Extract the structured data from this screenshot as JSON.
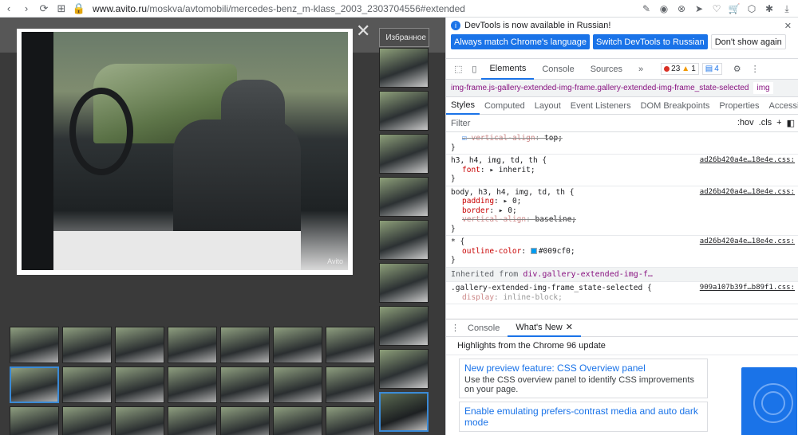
{
  "browser": {
    "url_prefix": "www.avito.ru",
    "url_path": "/moskva/avtomobili/mercedes-benz_m-klass_2003_2303704556#extended"
  },
  "gallery": {
    "favorite_label": "Избранное",
    "watermark": "Avito",
    "close_symbol": "✕",
    "side_thumbs_count": 9,
    "grid_rows": 3
  },
  "devtools": {
    "banner": {
      "message": "DevTools is now available in Russian!",
      "btn_match": "Always match Chrome's language",
      "btn_switch": "Switch DevTools to Russian",
      "btn_dont": "Don't show again"
    },
    "tabs": [
      "Elements",
      "Console",
      "Sources"
    ],
    "more": "»",
    "errors": "23",
    "warnings": "1",
    "messages": "4",
    "breadcrumb": "img-frame.js-gallery-extended-img-frame.gallery-extended-img-frame_state-selected",
    "breadcrumb_sel": "img",
    "subtabs": [
      "Styles",
      "Computed",
      "Layout",
      "Event Listeners",
      "DOM Breakpoints",
      "Properties",
      "Accessibility"
    ],
    "filter_placeholder": "Filter",
    "filter_hov": ":hov",
    "filter_cls": ".cls",
    "filter_plus": "+",
    "styles": {
      "r0_prop": "vertical-align",
      "r0_val": "top;",
      "r1_sel": "h3, h4, img, td, th {",
      "r1_src": "ad26b420a4e…18e4e.css:",
      "r1_prop": "font",
      "r1_val": "▸ inherit;",
      "r2_sel": "body, h3, h4, img, td, th {",
      "r2_src": "ad26b420a4e…18e4e.css:",
      "r2_p1": "padding",
      "r2_v1": "▸ 0;",
      "r2_p2": "border",
      "r2_v2": "▸ 0;",
      "r2_p3": "vertical-align",
      "r2_v3": "baseline;",
      "r3_sel": "* {",
      "r3_src": "ad26b420a4e…18e4e.css:",
      "r3_prop": "outline-color",
      "r3_val": "#009cf0;",
      "inherited_label": "Inherited from",
      "inherited_link": "div.gallery-extended-img-f…",
      "r4_sel": ".gallery-extended-img-frame_state-selected {",
      "r4_src": "909a107b39f…b89f1.css:",
      "r4_prop": "display",
      "r4_val": "inline-block;"
    },
    "drawer": {
      "tab_console": "Console",
      "tab_whatsnew": "What's New",
      "highlights": "Highlights from the Chrome 96 update",
      "card1_title": "New preview feature: CSS Overview panel",
      "card1_desc": "Use the CSS overview panel to identify CSS improvements on your page.",
      "card2_title": "Enable emulating prefers-contrast media and auto dark mode"
    }
  }
}
